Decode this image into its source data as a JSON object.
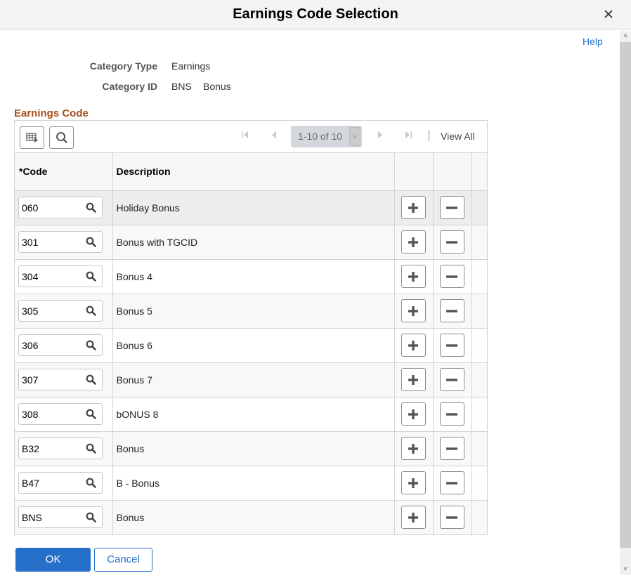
{
  "dialog": {
    "title": "Earnings Code Selection",
    "close_label": "×",
    "help_label": "Help"
  },
  "fields": {
    "category_type": {
      "label": "Category Type",
      "value": "Earnings"
    },
    "category_id": {
      "label": "Category ID",
      "value": "BNS",
      "description": "Bonus"
    }
  },
  "grid": {
    "title": "Earnings Code",
    "toolbar": {
      "personalize_icon": "grid-personalize-icon",
      "find_icon": "search-icon",
      "pager_text": "1-10 of 10",
      "view_all_label": "View All"
    },
    "columns": {
      "code": "*Code",
      "description": "Description"
    },
    "rows": [
      {
        "code": "060",
        "description": "Holiday Bonus"
      },
      {
        "code": "301",
        "description": "Bonus with TGCID"
      },
      {
        "code": "304",
        "description": "Bonus 4"
      },
      {
        "code": "305",
        "description": "Bonus 5"
      },
      {
        "code": "306",
        "description": "Bonus 6"
      },
      {
        "code": "307",
        "description": "Bonus 7"
      },
      {
        "code": "308",
        "description": "bONUS 8"
      },
      {
        "code": "B32",
        "description": "Bonus"
      },
      {
        "code": "B47",
        "description": "B - Bonus"
      },
      {
        "code": "BNS",
        "description": "Bonus"
      }
    ]
  },
  "footer": {
    "ok_label": "OK",
    "cancel_label": "Cancel"
  },
  "colors": {
    "accent": "#2770c9",
    "section_title": "#a5501a",
    "selected_row": "#ededed"
  }
}
